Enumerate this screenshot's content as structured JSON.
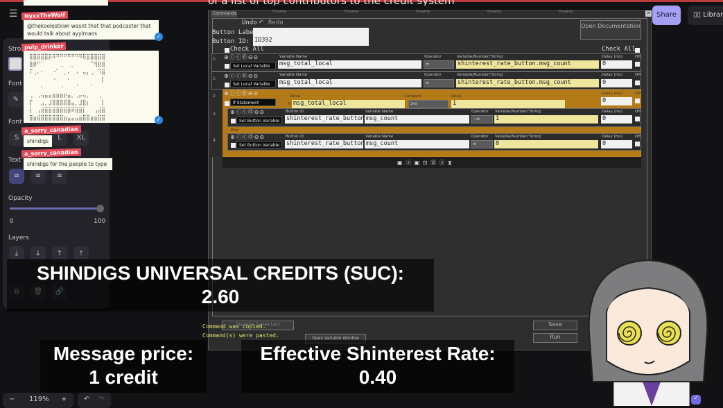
{
  "banner": {
    "text": "of a list of top contributors to the credit system"
  },
  "app": {
    "menu_icon": "hamburger-icon",
    "share_label": "Share",
    "library_label": "Library",
    "zoom_level": "119%",
    "zoom_out": "−",
    "zoom_in": "+",
    "undo": "↶",
    "redo": "↷"
  },
  "left_panel": {
    "stroke_label": "Stro",
    "font_label": "Font",
    "font_size_label": "Font",
    "sizes": [
      "S",
      "M",
      "L",
      "XL"
    ],
    "text_align_label": "Text",
    "opacity_label": "Opacity",
    "opacity_min": "0",
    "opacity_max": "100",
    "opacity_value": 100,
    "layers_label": "Layers",
    "layer_buttons": [
      "⤓",
      "↓",
      "↑",
      "⤒"
    ],
    "action_icons": [
      "⧉",
      "🗑",
      "🔗"
    ]
  },
  "chat": [
    {
      "name": "NyxxTheWolf",
      "text": "@thekoolestkiwi wasnt that that podcaster that would talk about ayylmaos"
    },
    {
      "name": "pulp_drinker",
      "text": "⣿⣿⣿⣿⣿⡿⠿⠛⠛⠛⠛⠛⠛⠻⢿⣿⣿⣿⣿⣿\n⣿⡿⠋⠁⠀⠀⠀⠀⢀⠀⠀⡀⠀⠀⠀⠀⠉⢻⣿⣿\n⠏⢀⠄⠂⠀⠀⠐⠁⠀⡀⠄⠀⠠⠀⢤⡄⢀⠀⠹⣿\n⠀⠀⠀⠀⠀⠀⠐⠀⠀⠀⠂⠀⠀⠀⠀⠀⠀⠀⠀⡇\n⠀⠀⠀⠂⠀⠀⠀⠀⠐⠀⠀⠀⠈⠀⠀⠀⠁⠀⠀⠀\n⢀⠀⢀⢤⣤⣤⣶⣶⣶⡶⣤⡀⢀⡤⢤⡀⠀⠀⢀⠀\n⡏⠀⠀⣠⡀⣸⣿⣿⣿⣿⣿⣤⡀⣸⣿⡆⠀⠀⠀⡇\n⡇⠀⢠⣾⣿⣿⣿⣿⣿⣿⣿⠿⣿⣿⡇⠀⠀⢠⣼⣿\n⣿⣶⣾⣿⣿⣿⣿⣿⣿⣶⣤⣤⣤⣶⣿⣿⣶⣶⣿⣿"
    },
    {
      "name": "a_sorry_canadian",
      "text": "shindigs"
    },
    {
      "name": "a_sorry_canadian",
      "text": "shindigs for the people to type"
    }
  ],
  "commands_window": {
    "tab_title": "Commands",
    "disable_tabs": [
      "Disable",
      "Disable",
      "Disable",
      "Disable",
      "Disable"
    ],
    "undo": "Undo",
    "redo": "Redo",
    "button_label_label": "Button Label:",
    "button_label_value": "",
    "button_id_label": "Button ID:",
    "button_id_value": "ID392",
    "open_docs": "Open Documentation",
    "check_all": "Check All",
    "rows": [
      {
        "index": "0",
        "type": "Set Local Variable",
        "var_label": "Variable Name",
        "var": "msg_total_local",
        "op_label": "Operator",
        "op": "=",
        "val_label": "Variable/Number/'String'",
        "val": "shinterest_rate_button.msg_count",
        "delay_label": "Delay (ms)",
        "delay": "0",
        "off": "Off"
      },
      {
        "index": "1",
        "type": "Set Local Variable",
        "var_label": "Variable Name",
        "var": "msg_total_local",
        "op_label": "Operator",
        "op": "=",
        "val_label": "Variable/Number/'String'",
        "val": "shinterest_rate_button.msg_count",
        "delay_label": "Delay (ms)",
        "delay": "0",
        "off": "Off"
      },
      {
        "index": "2",
        "type": "If Statement",
        "if": "If",
        "value_label": "Value",
        "left": "msg_total_local",
        "compare_label": "Compare",
        "compare": ">=",
        "value2_label": "Value",
        "right": "1",
        "delay_label": "Delay (ms)",
        "delay": "0",
        "off": "Off"
      },
      {
        "index": "3",
        "type": "Set Button Variable",
        "bid_label": "Button ID",
        "bid": "shinterest_rate_button",
        "var_label": "Variable Name",
        "var": "msg_count",
        "op_label": "Operator",
        "op": "-=",
        "val_label": "Variable/Number/'String'",
        "val": "1",
        "delay_label": "Delay (ms)",
        "delay": "0",
        "off": "Off"
      },
      {
        "index": "4",
        "type": "Set Button Variable",
        "bid_label": "Button ID",
        "bid": "shinterest_rate_button",
        "var_label": "Variable Name",
        "var": "msg_count",
        "op_label": "Operator",
        "op": "=",
        "val_label": "Variable/Number/'String'",
        "val": "0",
        "delay_label": "Delay (ms)",
        "delay": "0",
        "off": "Off"
      }
    ],
    "else_label": "Else",
    "row_icons": "⊕ⓒⓒ⓪⊖⊝",
    "bottom_icons": "▣ ⓐ ▣ ⊡ ⑫ ⓐ ⧗",
    "status": [
      "Command was copied.",
      "Command(s) were pasted."
    ],
    "hidden_btn": "Delete Selected",
    "open_var_window": "Open Variable Window",
    "save": "Save",
    "run": "Run"
  },
  "captions": {
    "suc_title": "SHINDIGS UNIVERSAL CREDITS (SUC):",
    "suc_value": "2.60",
    "price_title": "Message price:",
    "price_value": "1 credit",
    "rate_title": "Effective Shinterest Rate:",
    "rate_value": "0.40"
  }
}
